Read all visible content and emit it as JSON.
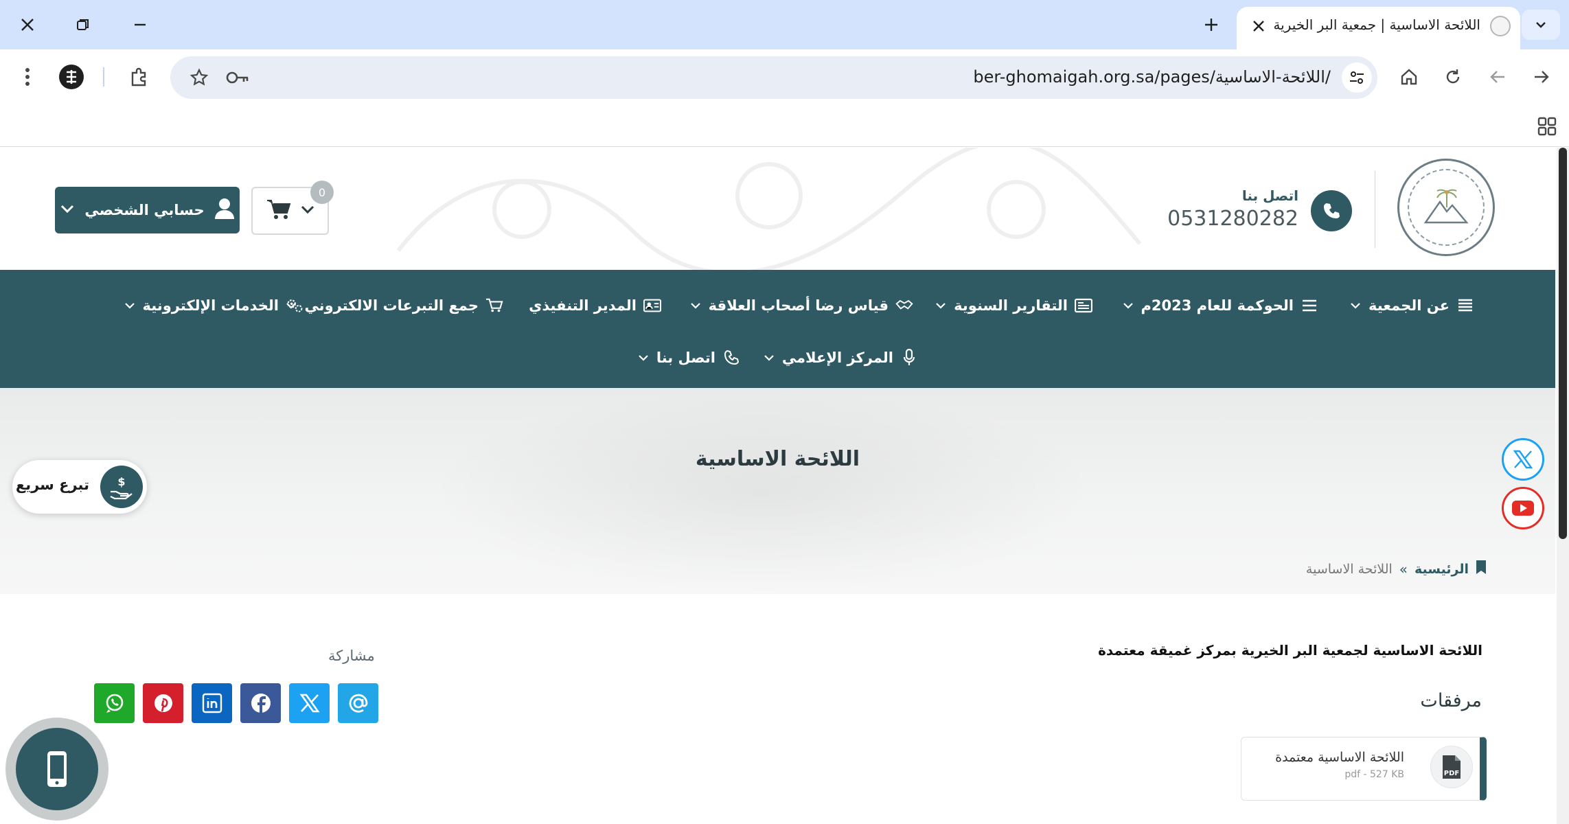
{
  "browser": {
    "tab_title": "اللائحة الاساسية | جمعية البر الخيرية",
    "url": "ber-ghomaigah.org.sa/pages/اللائحة-الاساسية/",
    "window_controls": [
      "close-icon",
      "restore-icon",
      "minimize-icon"
    ]
  },
  "header": {
    "contact_label": "اتصل بنا",
    "phone": "0531280282",
    "account_label": "حسابي الشخصي",
    "cart_count": "0"
  },
  "nav": {
    "items": [
      {
        "label": "عن الجمعية",
        "icon": "list-icon"
      },
      {
        "label": "الحوكمة للعام 2023م",
        "icon": "menu-icon"
      },
      {
        "label": "التقارير السنوية",
        "icon": "newspaper-icon"
      },
      {
        "label": "قياس رضا أصحاب العلاقة",
        "icon": "handshake-icon"
      },
      {
        "label": "المدير التنفيذي",
        "icon": "id-card-icon"
      },
      {
        "label": "جمع التبرعات الالكتروني",
        "icon": "cart-icon"
      },
      {
        "label": "الخدمات الإلكترونية",
        "icon": "gears-icon"
      },
      {
        "label": "المركز الإعلامي",
        "icon": "microphone-icon"
      },
      {
        "label": "اتصل بنا",
        "icon": "phone-icon"
      }
    ]
  },
  "page": {
    "title": "اللائحة الاساسية",
    "breadcrumb_home": "الرئيسية",
    "breadcrumb_sep": "»",
    "breadcrumb_current": "اللائحة الاساسية",
    "description": "اللائحة الاساسية لجمعية البر الخيرية بمركز غميقة معتمدة",
    "attachments_title": "مرفقات",
    "attachment": {
      "name": "اللائحة الاساسية معتمدة",
      "meta": "pdf - 527 KB"
    },
    "share_label": "مشاركة",
    "quick_donate": "تبرع سريع"
  },
  "colors": {
    "primary": "#2f5a64",
    "whatsapp": "#1fa82a",
    "pinterest": "#d4202d",
    "linkedin": "#0b66c2",
    "facebook": "#3b5998",
    "x": "#1da1f2",
    "email": "#22a6e8"
  }
}
